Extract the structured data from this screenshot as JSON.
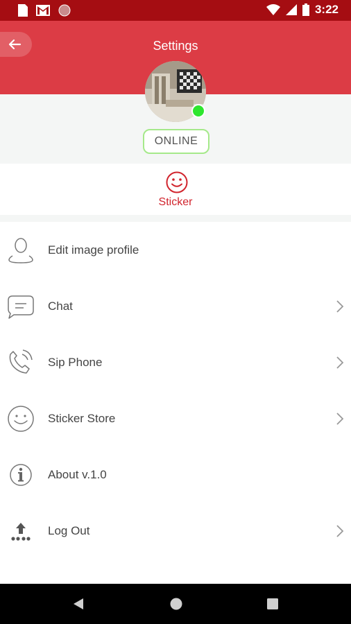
{
  "status_bar": {
    "time": "3:22",
    "left_icons": [
      "sim-card-icon",
      "gmail-icon",
      "circle-app-icon"
    ],
    "right_icons": [
      "wifi-icon",
      "cell-signal-icon",
      "battery-icon"
    ]
  },
  "header": {
    "title": "Settings",
    "background": "#dc3c45"
  },
  "profile": {
    "status": "ONLINE",
    "online_color": "#2ee62e"
  },
  "sticker": {
    "label": "Sticker",
    "color": "#d1242d"
  },
  "menu": {
    "items": [
      {
        "label": "Edit image profile",
        "icon": "user-profile-icon",
        "chevron": false
      },
      {
        "label": "Chat",
        "icon": "chat-bubble-icon",
        "chevron": true
      },
      {
        "label": "Sip Phone",
        "icon": "phone-ringing-icon",
        "chevron": true
      },
      {
        "label": "Sticker Store",
        "icon": "smiley-icon",
        "chevron": true
      },
      {
        "label": "About v.1.0",
        "icon": "info-icon",
        "chevron": false
      },
      {
        "label": "Log Out",
        "icon": "logout-icon",
        "chevron": true
      }
    ]
  },
  "nav_bar": {
    "buttons": [
      "back-triangle-icon",
      "home-circle-icon",
      "recents-square-icon"
    ]
  }
}
